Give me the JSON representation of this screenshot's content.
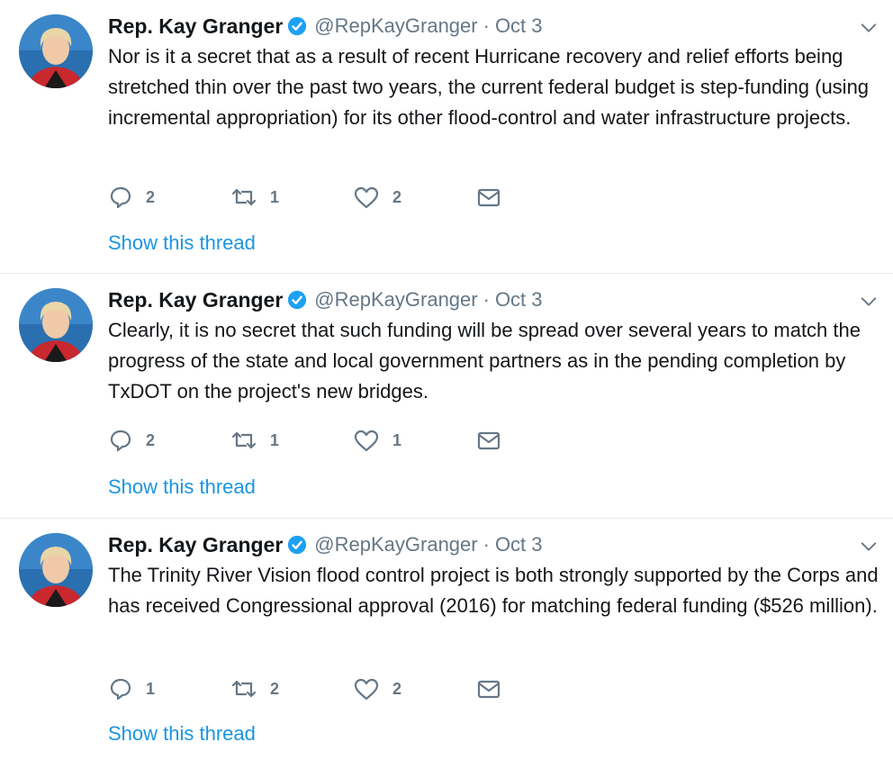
{
  "colors": {
    "accent": "#1b95e0",
    "muted": "#657786",
    "text": "#14171a",
    "verified": "#1da1f2"
  },
  "icons": {
    "verified": "verified-badge-icon",
    "caret": "chevron-down-icon",
    "reply": "reply-icon",
    "retweet": "retweet-icon",
    "like": "heart-icon",
    "dm": "envelope-icon"
  },
  "tweets": [
    {
      "name": "Rep. Kay Granger",
      "handle": "@RepKayGranger",
      "separator": "·",
      "time": "Oct 3",
      "text": "Nor is it a secret that as a result of recent Hurricane recovery and relief efforts being stretched thin over the past two years, the current federal budget is step-funding (using incremental appropriation) for its other flood-control and water infrastructure projects.",
      "replies": "2",
      "retweets": "1",
      "likes": "2",
      "show_thread": "Show this thread"
    },
    {
      "name": "Rep. Kay Granger",
      "handle": "@RepKayGranger",
      "separator": "·",
      "time": "Oct 3",
      "text": "Clearly, it is no secret that such funding will be spread over several years to match the progress of the state and local government partners as in the pending completion by TxDOT on the project's new bridges.",
      "replies": "2",
      "retweets": "1",
      "likes": "1",
      "show_thread": "Show this thread"
    },
    {
      "name": "Rep. Kay Granger",
      "handle": "@RepKayGranger",
      "separator": "·",
      "time": "Oct 3",
      "text": "The Trinity River Vision flood control project is both strongly supported by the Corps and has received Congressional approval (2016) for matching federal funding ($526 million).",
      "replies": "1",
      "retweets": "2",
      "likes": "2",
      "show_thread": "Show this thread"
    }
  ]
}
